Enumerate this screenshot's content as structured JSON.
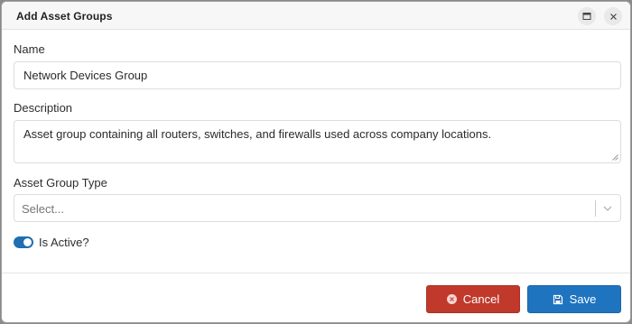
{
  "dialog": {
    "title": "Add Asset Groups",
    "maximize_icon": "window-maximize-icon",
    "close_icon": "close-icon"
  },
  "form": {
    "name": {
      "label": "Name",
      "value": "Network Devices Group"
    },
    "description": {
      "label": "Description",
      "value": "Asset group containing all routers, switches, and firewalls used across company locations."
    },
    "asset_group_type": {
      "label": "Asset Group Type",
      "placeholder": "Select..."
    },
    "is_active": {
      "label": "Is Active?",
      "checked": true
    }
  },
  "footer": {
    "cancel_label": "Cancel",
    "save_label": "Save"
  },
  "colors": {
    "cancel": "#c0392b",
    "save": "#1f74bf",
    "toggle_on": "#1f6fb2"
  }
}
